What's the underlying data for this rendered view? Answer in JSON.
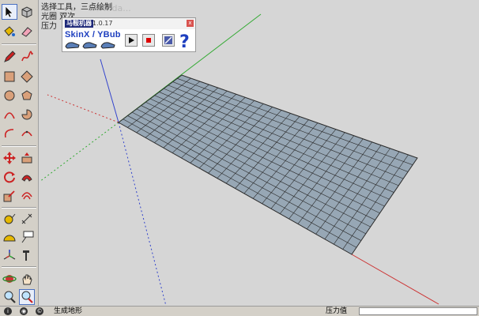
{
  "viewport": {
    "overlay_lines": [
      "选择工具，三点绘制",
      "光圈 双次...",
      "压力"
    ],
    "watermark": "www.da..."
  },
  "plugin": {
    "title_name": "马鞍机器",
    "version": "1.0.17",
    "close_glyph": "x",
    "label": "SkinX / YBub",
    "buttons": [
      "sled-1-icon",
      "sled-2-icon",
      "sled-3-icon",
      "play-icon",
      "stop-icon",
      "edit-icon",
      "help-icon"
    ]
  },
  "tools": [
    "select-icon",
    "component-icon",
    "paint-bucket-icon",
    "eraser-icon",
    "pencil-icon",
    "freehand-icon",
    "rectangle-icon",
    "rotated-rectangle-icon",
    "circle-icon",
    "polygon-icon",
    "arc-icon",
    "pie-icon",
    "two-point-arc-icon",
    "three-point-arc-icon",
    "move-icon",
    "push-pull-icon",
    "rotate-icon",
    "follow-me-icon",
    "scale-icon",
    "offset-icon",
    "tape-measure-icon",
    "dimension-icon",
    "protractor-icon",
    "text-icon",
    "axes-icon",
    "3d-text-icon",
    "orbit-icon",
    "pan-icon",
    "zoom-icon",
    "zoom-extents-icon"
  ],
  "status": {
    "icons": [
      "info-icon",
      "geolocation-icon",
      "credits-icon"
    ],
    "message": "生成地形",
    "vcb_label": "压力值",
    "vcb_value": ""
  },
  "colors": {
    "grid_fill": "#97a7b5",
    "grid_line": "#2a2a2a",
    "axis_red": "#cc3333",
    "axis_green": "#33aa33",
    "axis_blue": "#3344cc"
  }
}
